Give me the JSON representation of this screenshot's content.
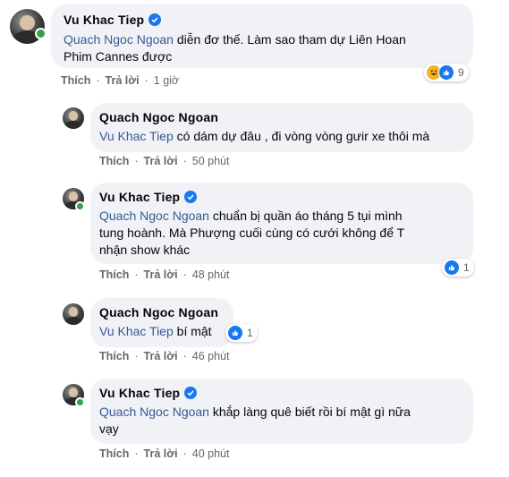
{
  "actions": {
    "like": "Thích",
    "reply": "Trả lời",
    "sep": "·"
  },
  "colors": {
    "like_blue": "#1877f2",
    "haha_yellow": "#f7b125",
    "mention": "#385898",
    "online": "#31a24c"
  },
  "comments": [
    {
      "author": "Vu Khac Tiep",
      "verified": true,
      "mention": "Quach Ngoc Ngoan",
      "line1": "diễn đơ thế. Làm sao tham dự Liên Hoan",
      "line2": "Phim Cannes được",
      "time": "1 giờ",
      "reactions": [
        "haha",
        "like"
      ],
      "reaction_count": "9"
    },
    {
      "author": "Quach Ngoc Ngoan",
      "verified": false,
      "mention": "Vu Khac Tiep",
      "line1": "có dám dự đâu , đi vòng vòng gưir xe thôi mà",
      "time": "50 phút"
    },
    {
      "author": "Vu Khac Tiep",
      "verified": true,
      "mention": "Quach Ngoc Ngoan",
      "line1": "chuẩn bị quần áo tháng 5 tụi mình",
      "line2": "tung hoành. Mà Phượng cuối cùng có cưới không để T",
      "line3": "nhận show khác",
      "time": "48 phút",
      "reactions": [
        "like"
      ],
      "reaction_count": "1"
    },
    {
      "author": "Quach Ngoc Ngoan",
      "verified": false,
      "mention": "Vu Khac Tiep",
      "line1": "bí mật",
      "time": "46 phút",
      "reactions": [
        "like"
      ],
      "reaction_count": "1"
    },
    {
      "author": "Vu Khac Tiep",
      "verified": true,
      "mention": "Quach Ngoc Ngoan",
      "line1": "khắp làng quê biết rồi bí mật gì nữa",
      "line2": "vạy",
      "time": "40 phút"
    }
  ]
}
